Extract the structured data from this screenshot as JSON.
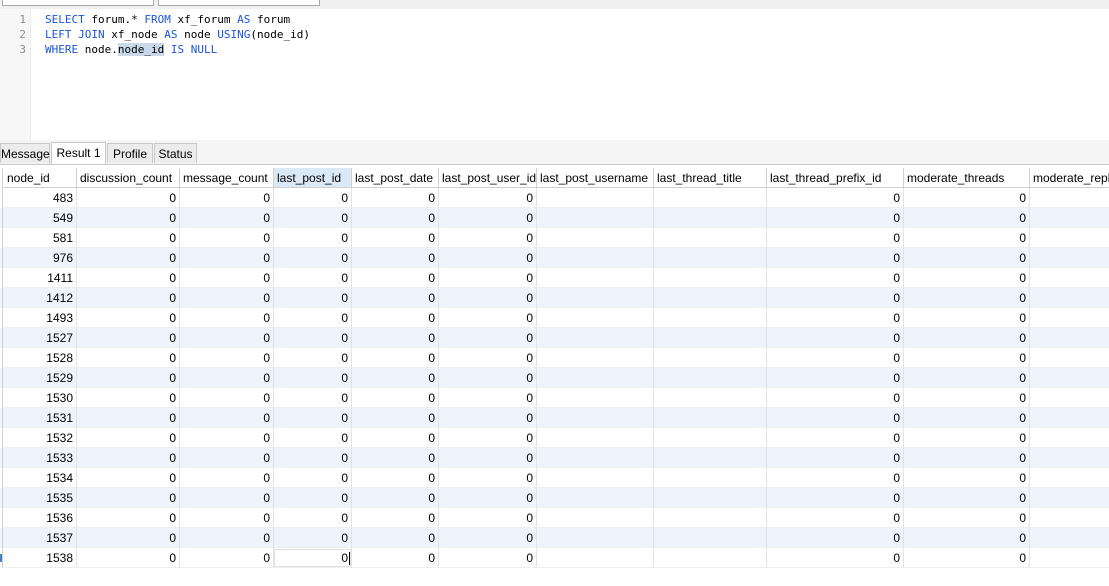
{
  "editor": {
    "lines": [
      {
        "num": "1",
        "segments": [
          {
            "t": "SELECT",
            "c": "kw"
          },
          {
            "t": " forum.* ",
            "c": ""
          },
          {
            "t": "FROM",
            "c": "kw"
          },
          {
            "t": " xf_forum ",
            "c": ""
          },
          {
            "t": "AS",
            "c": "kw"
          },
          {
            "t": " forum",
            "c": ""
          }
        ]
      },
      {
        "num": "2",
        "segments": [
          {
            "t": "LEFT JOIN",
            "c": "kw"
          },
          {
            "t": " xf_node ",
            "c": ""
          },
          {
            "t": "AS",
            "c": "kw"
          },
          {
            "t": " node ",
            "c": ""
          },
          {
            "t": "USING",
            "c": "kw"
          },
          {
            "t": "(node_id)",
            "c": ""
          }
        ]
      },
      {
        "num": "3",
        "segments": [
          {
            "t": "WHERE",
            "c": "kw"
          },
          {
            "t": " node.",
            "c": ""
          },
          {
            "t": "node_id",
            "c": "sel"
          },
          {
            "t": " ",
            "c": ""
          },
          {
            "t": "IS NULL",
            "c": "kw"
          }
        ]
      }
    ]
  },
  "tabs": [
    {
      "label": "Message",
      "active": false
    },
    {
      "label": "Result 1",
      "active": true
    },
    {
      "label": "Profile",
      "active": false
    },
    {
      "label": "Status",
      "active": false
    }
  ],
  "grid": {
    "columns": [
      "node_id",
      "discussion_count",
      "message_count",
      "last_post_id",
      "last_post_date",
      "last_post_user_id",
      "last_post_username",
      "last_thread_title",
      "last_thread_prefix_id",
      "moderate_threads",
      "moderate_repl"
    ],
    "highlighted_column": "last_post_id",
    "rows": [
      [
        "483",
        "0",
        "0",
        "0",
        "0",
        "0",
        "",
        "",
        "0",
        "0"
      ],
      [
        "549",
        "0",
        "0",
        "0",
        "0",
        "0",
        "",
        "",
        "0",
        "0"
      ],
      [
        "581",
        "0",
        "0",
        "0",
        "0",
        "0",
        "",
        "",
        "0",
        "0"
      ],
      [
        "976",
        "0",
        "0",
        "0",
        "0",
        "0",
        "",
        "",
        "0",
        "0"
      ],
      [
        "1411",
        "0",
        "0",
        "0",
        "0",
        "0",
        "",
        "",
        "0",
        "0"
      ],
      [
        "1412",
        "0",
        "0",
        "0",
        "0",
        "0",
        "",
        "",
        "0",
        "0"
      ],
      [
        "1493",
        "0",
        "0",
        "0",
        "0",
        "0",
        "",
        "",
        "0",
        "0"
      ],
      [
        "1527",
        "0",
        "0",
        "0",
        "0",
        "0",
        "",
        "",
        "0",
        "0"
      ],
      [
        "1528",
        "0",
        "0",
        "0",
        "0",
        "0",
        "",
        "",
        "0",
        "0"
      ],
      [
        "1529",
        "0",
        "0",
        "0",
        "0",
        "0",
        "",
        "",
        "0",
        "0"
      ],
      [
        "1530",
        "0",
        "0",
        "0",
        "0",
        "0",
        "",
        "",
        "0",
        "0"
      ],
      [
        "1531",
        "0",
        "0",
        "0",
        "0",
        "0",
        "",
        "",
        "0",
        "0"
      ],
      [
        "1532",
        "0",
        "0",
        "0",
        "0",
        "0",
        "",
        "",
        "0",
        "0"
      ],
      [
        "1533",
        "0",
        "0",
        "0",
        "0",
        "0",
        "",
        "",
        "0",
        "0"
      ],
      [
        "1534",
        "0",
        "0",
        "0",
        "0",
        "0",
        "",
        "",
        "0",
        "0"
      ],
      [
        "1535",
        "0",
        "0",
        "0",
        "0",
        "0",
        "",
        "",
        "0",
        "0"
      ],
      [
        "1536",
        "0",
        "0",
        "0",
        "0",
        "0",
        "",
        "",
        "0",
        "0"
      ],
      [
        "1537",
        "0",
        "0",
        "0",
        "0",
        "0",
        "",
        "",
        "0",
        "0"
      ],
      [
        "1538",
        "0",
        "0",
        "0",
        "0",
        "0",
        "",
        "",
        "0",
        "0"
      ]
    ],
    "editing_row": 18,
    "editing_value": "0"
  },
  "colors": {
    "keyword": "#1a56d6",
    "alt_row": "#eef4fb",
    "header_highlight": "#dbe8f6"
  }
}
